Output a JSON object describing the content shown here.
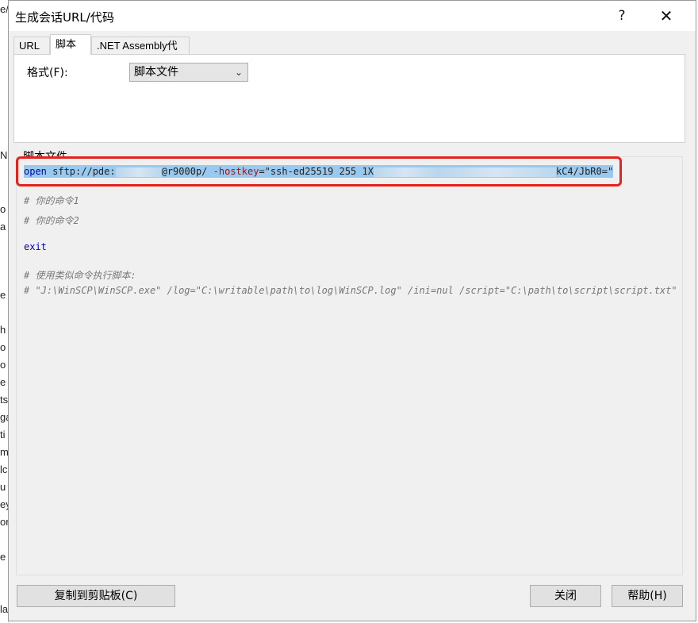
{
  "background_window": {
    "letters": [
      "e/",
      "N",
      "o",
      "a",
      "e",
      "h",
      "o",
      "o",
      "e",
      "ts",
      "ga",
      "ti",
      "m",
      "lc",
      "u",
      "ey",
      "or",
      "e",
      "la"
    ]
  },
  "dialog": {
    "title": "生成会话URL/代码",
    "help_button": "?",
    "close_button": "✕"
  },
  "tabs": [
    {
      "label": "URL",
      "active": false
    },
    {
      "label": "脚本",
      "active": true
    },
    {
      "label": ".NET Assembly代码",
      "active": false
    }
  ],
  "format": {
    "label": "格式(F):",
    "selected": "脚本文件"
  },
  "script": {
    "group_label": "脚本文件",
    "line1": {
      "kw": "open",
      "prefix": " sftp://pde:",
      "host": "@r9000p/ ",
      "opt": "-hostkey",
      "eq": "=",
      "key_start": "\"ssh-ed25519 255 1X",
      "key_end": "kC4/JbR0=\""
    },
    "comment1": "# 你的命令1",
    "comment2": "# 你的命令2",
    "exit": "exit",
    "comment3": "# 使用类似命令执行脚本:",
    "comment4": "# \"J:\\WinSCP\\WinSCP.exe\" /log=\"C:\\writable\\path\\to\\log\\WinSCP.log\" /ini=nul /script=\"C:\\path\\to\\script\\script.txt\""
  },
  "buttons": {
    "copy": "复制到剪贴板(C)",
    "close": "关闭",
    "help": "帮助(H)"
  },
  "colors": {
    "highlight_border": "#e8221b",
    "selection": "#99c9ef",
    "keyword": "#0000c0",
    "option": "#a31515"
  }
}
